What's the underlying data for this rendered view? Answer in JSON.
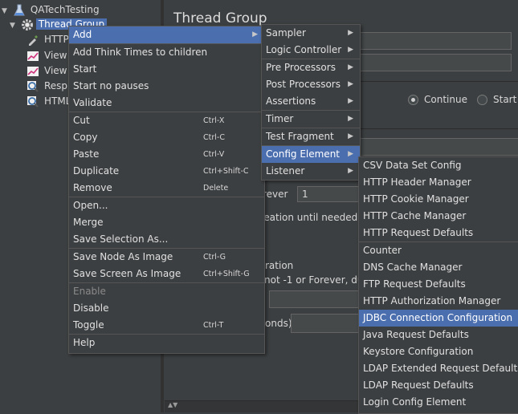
{
  "tree": {
    "items": [
      {
        "label": "QATechTesting"
      },
      {
        "label": "Thread Group"
      },
      {
        "label": "HTTP"
      },
      {
        "label": "View"
      },
      {
        "label": "View"
      },
      {
        "label": "Resp"
      },
      {
        "label": "HTML"
      }
    ]
  },
  "panel": {
    "title": "Thread Group",
    "radio_continue": "Continue",
    "radio_start": "Start",
    "partial_forever": "rever",
    "partial_loop_value": "1",
    "partial_creation": "creation until needed",
    "partial_duration": "ration",
    "partial_not_forever": "not -1 or Forever, du",
    "partial_seconds": "onds)"
  },
  "context_menu": {
    "groups": [
      [
        {
          "label": "Add",
          "submenu": true,
          "highlighted": true
        }
      ],
      [
        {
          "label": "Add Think Times to children"
        },
        {
          "label": "Start"
        },
        {
          "label": "Start no pauses"
        },
        {
          "label": "Validate"
        }
      ],
      [
        {
          "label": "Cut",
          "shortcut": "Ctrl-X"
        },
        {
          "label": "Copy",
          "shortcut": "Ctrl-C"
        },
        {
          "label": "Paste",
          "shortcut": "Ctrl-V"
        },
        {
          "label": "Duplicate",
          "shortcut": "Ctrl+Shift-C"
        },
        {
          "label": "Remove",
          "shortcut": "Delete"
        }
      ],
      [
        {
          "label": "Open..."
        },
        {
          "label": "Merge"
        },
        {
          "label": "Save Selection As..."
        }
      ],
      [
        {
          "label": "Save Node As Image",
          "shortcut": "Ctrl-G"
        },
        {
          "label": "Save Screen As Image",
          "shortcut": "Ctrl+Shift-G"
        }
      ],
      [
        {
          "label": "Enable",
          "disabled": true
        },
        {
          "label": "Disable"
        },
        {
          "label": "Toggle",
          "shortcut": "Ctrl-T"
        }
      ],
      [
        {
          "label": "Help"
        }
      ]
    ]
  },
  "add_submenu": {
    "groups": [
      [
        {
          "label": "Sampler",
          "submenu": true
        },
        {
          "label": "Logic Controller",
          "submenu": true
        }
      ],
      [
        {
          "label": "Pre Processors",
          "submenu": true
        },
        {
          "label": "Post Processors",
          "submenu": true
        },
        {
          "label": "Assertions",
          "submenu": true
        }
      ],
      [
        {
          "label": "Timer",
          "submenu": true
        }
      ],
      [
        {
          "label": "Test Fragment",
          "submenu": true
        }
      ],
      [
        {
          "label": "Config Element",
          "submenu": true,
          "highlighted": true
        },
        {
          "label": "Listener",
          "submenu": true
        }
      ]
    ]
  },
  "config_submenu": {
    "groups": [
      [
        {
          "label": "CSV Data Set Config"
        },
        {
          "label": "HTTP Header Manager"
        },
        {
          "label": "HTTP Cookie Manager"
        },
        {
          "label": "HTTP Cache Manager"
        },
        {
          "label": "HTTP Request Defaults"
        }
      ],
      [
        {
          "label": "Counter"
        },
        {
          "label": "DNS Cache Manager"
        },
        {
          "label": "FTP Request Defaults"
        },
        {
          "label": "HTTP Authorization Manager"
        },
        {
          "label": "JDBC Connection Configuration",
          "highlighted": true
        },
        {
          "label": "Java Request Defaults"
        },
        {
          "label": "Keystore Configuration"
        },
        {
          "label": "LDAP Extended Request Defaults"
        },
        {
          "label": "LDAP Request Defaults"
        },
        {
          "label": "Login Config Element"
        }
      ]
    ]
  },
  "colors": {
    "background": "#3c3f41",
    "highlight": "#4b6eaf",
    "text": "#e0e0e0",
    "disabled_text": "#8a8a8a"
  }
}
